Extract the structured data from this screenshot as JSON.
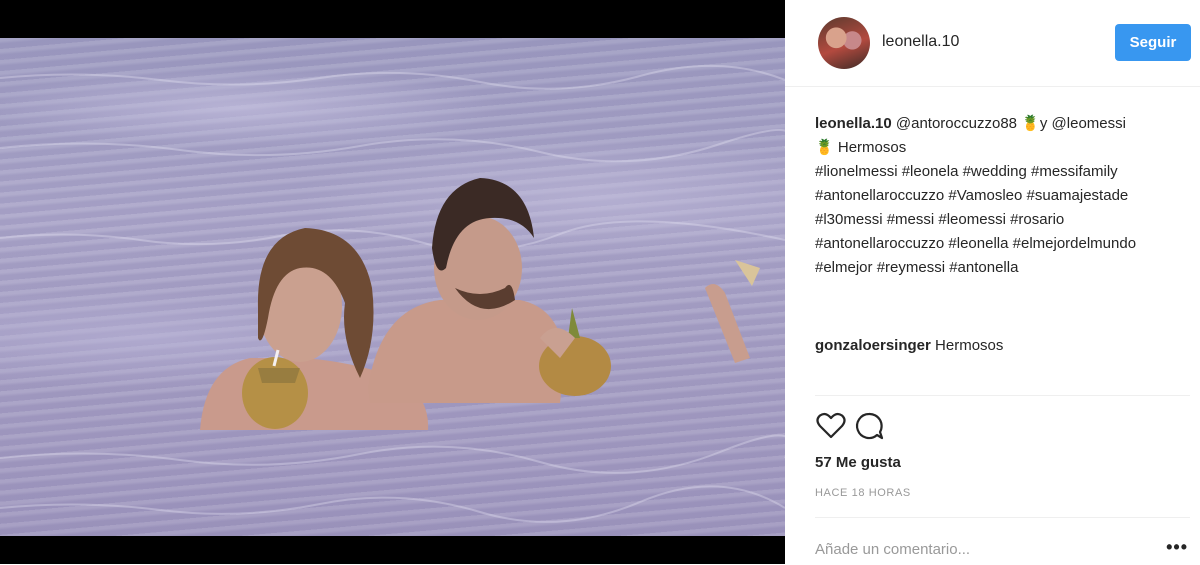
{
  "post": {
    "username": "leonella.10",
    "follow_label": "Seguir",
    "caption": {
      "username": "leonella.10",
      "text_1": " @antoroccuzzo88 ",
      "emoji_1": "🍍",
      "text_2": "y @leomessi",
      "emoji_2": "🍍",
      "text_3": " Hermosos",
      "hashtags": "#lionelmessi #leonela #wedding #messifamily #antonellaroccuzzo #Vamosleo #suamajestade #l30messi #messi #leomessi #rosario #antonellaroccuzzo #leonella #elmejordelmundo #elmejor #reymessi #antonella"
    },
    "comments": [
      {
        "username": "gonzaloersinger",
        "text": " Hermosos"
      }
    ],
    "likes": "57 Me gusta",
    "timestamp": "HACE 18 HORAS",
    "comment_placeholder": "Añade un comentario...",
    "more_label": "•••",
    "icons": {
      "like": "heart-icon",
      "comment": "comment-bubble-icon"
    },
    "colors": {
      "follow_button": "#3897f0",
      "text": "#262626",
      "muted": "#999999"
    }
  }
}
